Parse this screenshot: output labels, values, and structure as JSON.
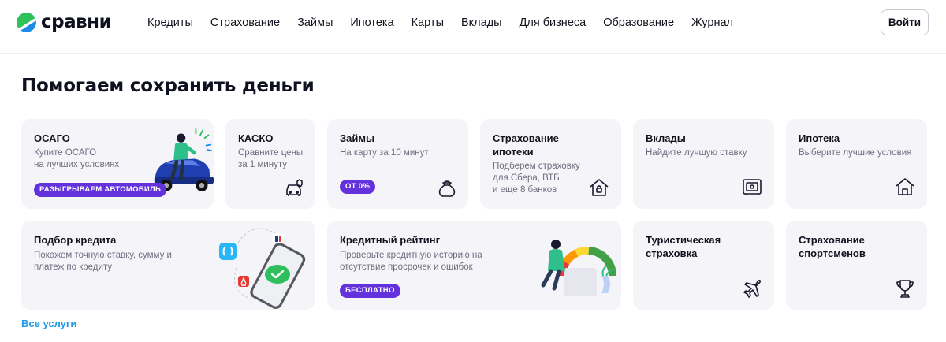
{
  "header": {
    "logo_text": "сравни",
    "nav": [
      "Кредиты",
      "Страхование",
      "Займы",
      "Ипотека",
      "Карты",
      "Вклады",
      "Для бизнеса",
      "Образование",
      "Журнал"
    ],
    "login_label": "Войти"
  },
  "page_title": "Помогаем сохранить деньги",
  "cards": {
    "osago": {
      "title": "ОСАГО",
      "sub1": "Купите ОСАГО",
      "sub2": "на лучших условиях",
      "badge": "РАЗЫГРЫВАЕМ АВТОМОБИЛЬ"
    },
    "kasko": {
      "title": "КАСКО",
      "sub1": "Сравните цены",
      "sub2": "за 1 минуту",
      "icon": "car-icon"
    },
    "loans": {
      "title": "Займы",
      "sub1": "На карту за 10 минут",
      "badge": "ОТ 0%",
      "icon": "money-bag-icon"
    },
    "mortgage_insurance": {
      "title1": "Страхование",
      "title2": "ипотеки",
      "sub1": "Подберем страховку",
      "sub2": "для Сбера, ВТБ",
      "sub3": "и еще 8 банков",
      "icon": "house-shield-icon"
    },
    "deposits": {
      "title": "Вклады",
      "sub1": "Найдите лучшую ставку",
      "icon": "safe-icon"
    },
    "mortgage": {
      "title": "Ипотека",
      "sub1": "Выберите лучшие условия",
      "icon": "house-icon"
    },
    "credit_selection": {
      "title": "Подбор кредита",
      "sub1": "Покажем точную ставку, сумму и",
      "sub2": "платеж по кредиту"
    },
    "credit_rating": {
      "title": "Кредитный рейтинг",
      "sub1": "Проверьте кредитную историю на",
      "sub2": "отсутствие просрочек и ошибок",
      "badge": "БЕСПЛАТНО"
    },
    "travel": {
      "title1": "Туристическая",
      "title2": "страховка",
      "icon": "airplane-icon"
    },
    "sport": {
      "title1": "Страхование",
      "title2": "спортсменов",
      "icon": "trophy-icon"
    }
  },
  "all_services": "Все услуги",
  "colors": {
    "accent": "#6432dc",
    "link": "#1d99e8",
    "card_bg": "#f5f4f8",
    "logo_green": "#2fc25b",
    "logo_blue": "#1d8ce8"
  }
}
